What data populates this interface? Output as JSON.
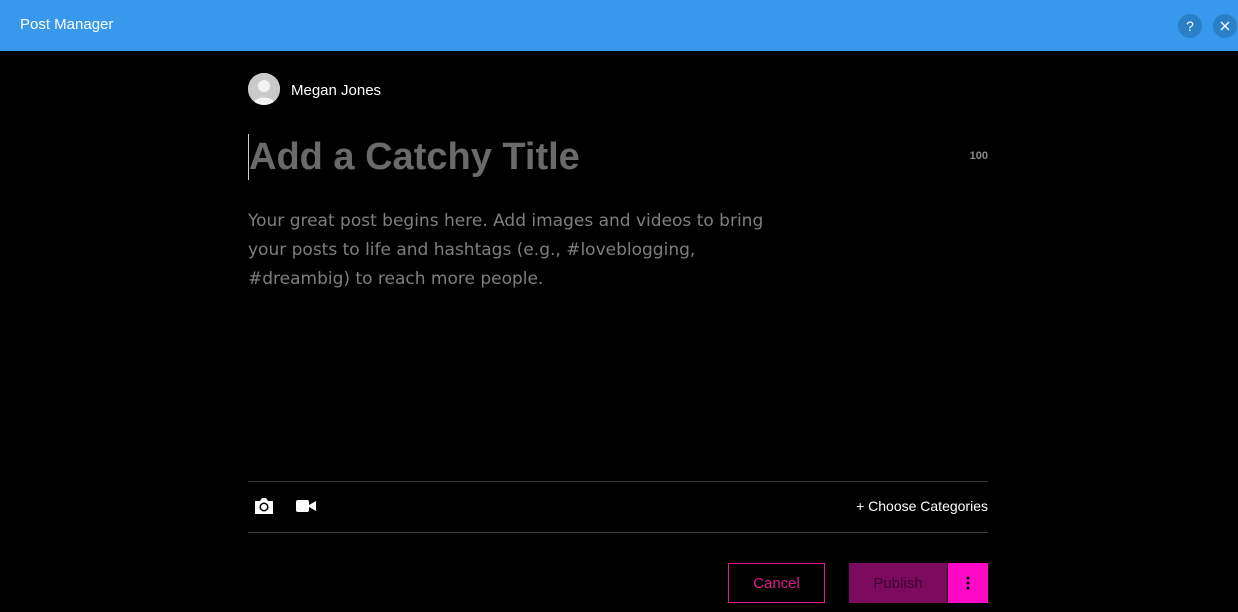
{
  "window": {
    "title": "Post Manager",
    "help_label": "?",
    "accent_color": "#3899EC"
  },
  "author": {
    "name": "Megan Jones"
  },
  "editor": {
    "title_placeholder": "Add a Catchy Title",
    "title_value": "",
    "char_count": "100",
    "body_placeholder": "Your great post begins here. Add images and videos to bring\nyour posts to life and hashtags (e.g., #loveblogging,\n#dreambig) to reach more people.",
    "body_value": ""
  },
  "toolbar": {
    "icons": [
      "camera-icon",
      "video-camera-icon"
    ],
    "categories_label": "+ Choose Categories"
  },
  "actions": {
    "cancel_label": "Cancel",
    "publish_label": "Publish",
    "brand_color": "#FF08C6"
  }
}
